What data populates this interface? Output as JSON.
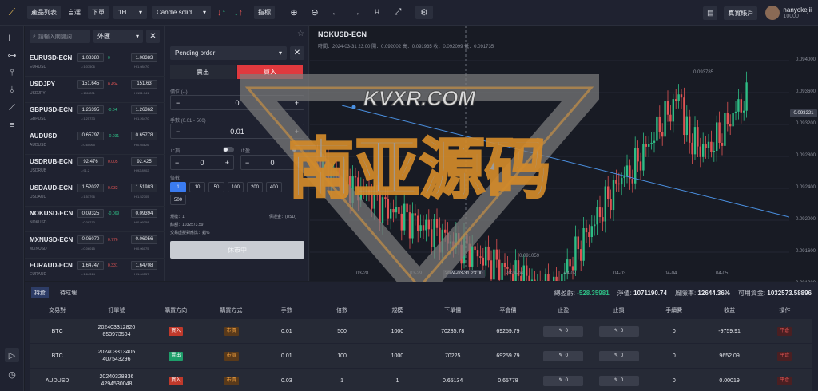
{
  "topbar": {
    "product_list": "產品列表",
    "self_select": "自選",
    "place_order": "下單",
    "timeframe": "1H",
    "chart_type": "Candle solid",
    "indicators": "指標",
    "account_mode": "真實賬戶",
    "user_name": "nanyokejii",
    "user_balance": "10000"
  },
  "watchlist": {
    "search_placeholder": "請輸入關鍵詞",
    "category": "外匯",
    "rows": [
      {
        "symbol": "EURUSD-ECN",
        "sub": "EURUSD",
        "bid": "1.08380",
        "ask": "1.08383",
        "low": "L:1.07506",
        "high": "H:1.08470",
        "change": "0",
        "change_color": "#2ebd85"
      },
      {
        "symbol": "USDJPY",
        "sub": "USDJPY",
        "bid": "151.645",
        "ask": "151.63",
        "low": "L:151.201",
        "high": "H:151.741",
        "change": "0.494",
        "change_color": "#e05454"
      },
      {
        "symbol": "GBPUSD-ECN",
        "sub": "GBPUSD",
        "bid": "1.26395",
        "ask": "1.26362",
        "low": "L:1.25733",
        "high": "H:1.26470",
        "change": "-0.04",
        "change_color": "#2ebd85"
      },
      {
        "symbol": "AUDUSD",
        "sub": "AUDUSD",
        "bid": "0.65797",
        "ask": "0.65778",
        "low": "L:0.65065",
        "high": "H:0.65826",
        "change": "-0.031",
        "change_color": "#2ebd85"
      },
      {
        "symbol": "USDRUB-ECN",
        "sub": "USDRUB",
        "bid": "92.476",
        "ask": "92.425",
        "low": "L:91.2",
        "high": "H:92.8902",
        "change": "0.005",
        "change_color": "#e05454"
      },
      {
        "symbol": "USDAUD-ECN",
        "sub": "USDAUD",
        "bid": "1.52027",
        "ask": "1.51983",
        "low": "L:1.51796",
        "high": "H:1.52705",
        "change": "0.032",
        "change_color": "#e05454"
      },
      {
        "symbol": "NOKUSD-ECN",
        "sub": "NOKUSD",
        "bid": "0.09325",
        "ask": "0.09394",
        "low": "L:0.09270",
        "high": "H:0.09358",
        "change": "-0.069",
        "change_color": "#2ebd85"
      },
      {
        "symbol": "MXNUSD-ECN",
        "sub": "MXNUSD",
        "bid": "0.06070",
        "ask": "0.06056",
        "low": "L:0.06015",
        "high": "H:0.06075",
        "change": "0.776",
        "change_color": "#e05454"
      },
      {
        "symbol": "EURAUD-ECN",
        "sub": "EURAUD",
        "bid": "1.64747",
        "ask": "1.64708",
        "low": "L:1.64314",
        "high": "H:1.64557",
        "change": "0.331",
        "change_color": "#e05454"
      }
    ]
  },
  "order": {
    "order_type": "Pending order",
    "sell_label": "賣出",
    "buy_label": "買入",
    "price_label": "價位 (--)",
    "price_value": "0",
    "lots_label": "手數 (0.01 - 500)",
    "lots_value": "0.01",
    "stop_loss_label": "止損",
    "take_profit_label": "止盈",
    "sl_value": "0",
    "tp_value": "0",
    "leverage_label": "倍數",
    "leverages": [
      "1",
      "10",
      "50",
      "100",
      "200",
      "400",
      "500"
    ],
    "lots_info": "規模：1",
    "margin_info": "保證金：(USD)",
    "balance_info": "餘額：1032573.59",
    "fee_info": "交易虛擬對應比：錯%",
    "submit": "休市中"
  },
  "chart": {
    "symbol": "NOKUSD-ECN",
    "ohlc": "時間：2024-03-31 23:00   開：0.092002   高：0.091935   收：0.092099   低：0.091735",
    "y_ticks": [
      "0.094000",
      "0.093600",
      "0.093200",
      "0.092800",
      "0.092400",
      "0.092000",
      "0.091600",
      "0.091200"
    ],
    "x_ticks": [
      "03-28",
      "03-29",
      "2024-04",
      "04-02",
      "04-03",
      "04-04",
      "04-05"
    ],
    "last_price": "0.093221",
    "crosshair_time": "2024-03-31 23:00",
    "high_label": "0.093785",
    "low_label": "0.091059",
    "watermark_latin": "KVXR.COM",
    "watermark_cjk": "南亚源码",
    "up_color": "#2ebd85",
    "down_color": "#e05454"
  },
  "positions": {
    "tab_positions": "持倉",
    "tab_pending": "待成理",
    "stats": {
      "pnl_label": "總盈虧:",
      "pnl": "-528.35981",
      "equity_label": "淨值:",
      "equity": "1071190.74",
      "risk_label": "風險率:",
      "risk": "12644.36%",
      "free_label": "可用資金:",
      "free": "1032573.58896"
    },
    "headers": [
      "交易對",
      "訂單號",
      "購買方向",
      "購買方式",
      "手數",
      "倍數",
      "規模",
      "下單價",
      "平倉價",
      "止盈",
      "止損",
      "手續費",
      "收益",
      "操作"
    ],
    "rows": [
      {
        "pair": "BTC",
        "order_no": "202403312820 653973504",
        "direction": "買入",
        "dir_color": "#c0392b",
        "method": "市價",
        "lots": "0.01",
        "leverage": "500",
        "size": "1000",
        "open_price": "70235.78",
        "close_price": "69259.79",
        "tp": "0",
        "sl": "0",
        "fee": "0",
        "profit": "-9759.91",
        "action": "平倉"
      },
      {
        "pair": "BTC",
        "order_no": "202403313405 407543296",
        "direction": "賣出",
        "dir_color": "#1e9e6a",
        "method": "市價",
        "lots": "0.01",
        "leverage": "100",
        "size": "1000",
        "open_price": "70225",
        "close_price": "69259.79",
        "tp": "0",
        "sl": "0",
        "fee": "0",
        "profit": "9652.09",
        "action": "平倉"
      },
      {
        "pair": "AUDUSD",
        "order_no": "20240328336 4294530048",
        "direction": "買入",
        "dir_color": "#c0392b",
        "method": "市價",
        "lots": "0.03",
        "leverage": "1",
        "size": "1",
        "open_price": "0.65134",
        "close_price": "0.65778",
        "tp": "0",
        "sl": "0",
        "fee": "0",
        "profit": "0.00019",
        "action": "平倉"
      }
    ]
  }
}
